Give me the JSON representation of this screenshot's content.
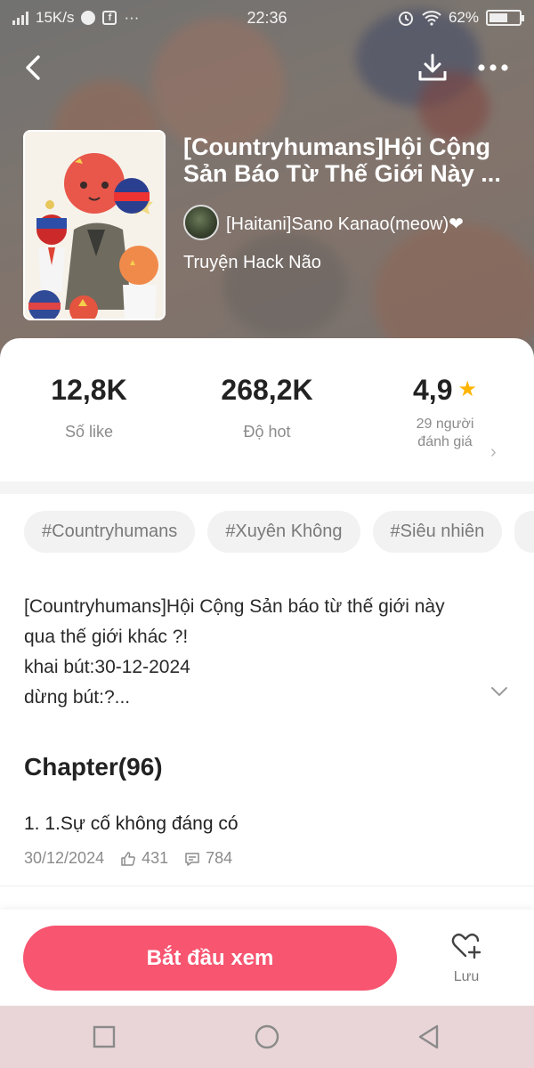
{
  "status_bar": {
    "speed": "15K/s",
    "time": "22:36",
    "battery": "62%",
    "battery_level": 0.62
  },
  "header": {
    "back_icon": "chevron-left-icon",
    "download_icon": "download-icon",
    "more_icon": "more-horizontal-icon"
  },
  "story": {
    "title": "[Countryhumans]Hội Cộng Sản Báo Từ Thế Giới Này ...",
    "author": "[Haitani]Sano Kanao(meow)❤",
    "category": "Truyện Hack Não"
  },
  "stats": {
    "likes_value": "12,8K",
    "likes_label": "Số like",
    "hot_value": "268,2K",
    "hot_label": "Độ hot",
    "rating_value": "4,9",
    "rating_label_line1": "29 người",
    "rating_label_line2": "đánh giá"
  },
  "tags": [
    "#Countryhumans",
    "#Xuyên Không",
    "#Siêu nhiên"
  ],
  "description": {
    "line1": "[Countryhumans]Hội Cộng Sản báo từ thế giới này",
    "line2": "qua thế giới khác ?!",
    "line3": "khai bút:30-12-2024",
    "line4": "dừng bút:?..."
  },
  "chapters": {
    "heading": "Chapter(96)",
    "items": [
      {
        "title": "1. 1.Sự cố không đáng có",
        "date": "30/12/2024",
        "likes": "431",
        "comments": "784"
      }
    ]
  },
  "actions": {
    "start_label": "Bắt đầu xem",
    "save_label": "Lưu"
  },
  "colors": {
    "accent": "#f75570",
    "star": "#ffb400",
    "nav_bg": "#e9d5d7"
  }
}
